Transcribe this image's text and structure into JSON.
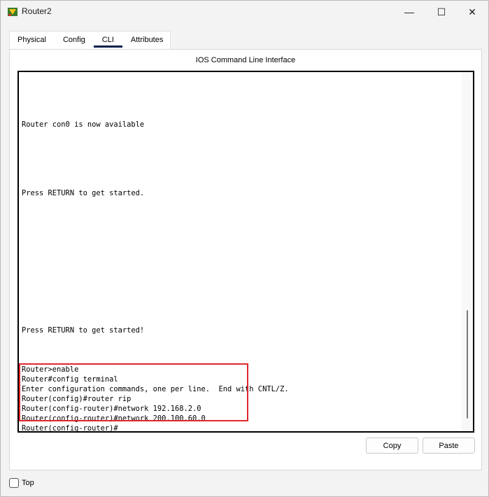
{
  "window": {
    "title": "Router2",
    "controls": {
      "minimize": "—",
      "maximize": "☐",
      "close": "✕"
    }
  },
  "tabs": [
    {
      "label": "Physical"
    },
    {
      "label": "Config"
    },
    {
      "label": "CLI"
    },
    {
      "label": "Attributes"
    }
  ],
  "active_tab": "CLI",
  "panel": {
    "title": "IOS Command Line Interface"
  },
  "console": {
    "lines": [
      "Router con0 is now available",
      "Press RETURN to get started.",
      "Press RETURN to get started!",
      "Router>enable",
      "Router#config terminal",
      "Enter configuration commands, one per line.  End with CNTL/Z.",
      "Router(config)#router rip",
      "Router(config-router)#network 192.168.2.0",
      "Router(config-router)#network 200.100.60.0",
      "Router(config-router)#"
    ]
  },
  "buttons": {
    "copy": "Copy",
    "paste": "Paste"
  },
  "top_option": {
    "label": "Top",
    "checked": false
  },
  "colors": {
    "highlight": "#e0262b",
    "tab_indicator": "#0b1f4d"
  }
}
